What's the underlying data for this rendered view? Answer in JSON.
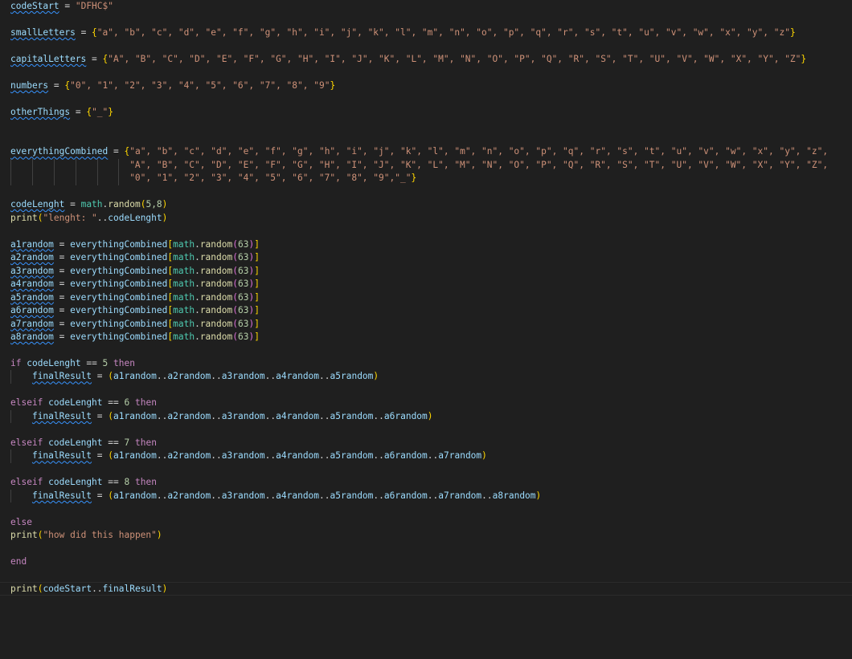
{
  "editor": {
    "code": {
      "code_start": {
        "var": "codeStart",
        "value": "\"DFHC$\""
      },
      "small_letters": {
        "var": "smallLetters",
        "values": "\"a\", \"b\", \"c\", \"d\", \"e\", \"f\", \"g\", \"h\", \"i\", \"j\", \"k\", \"l\", \"m\", \"n\", \"o\", \"p\", \"q\", \"r\", \"s\", \"t\", \"u\", \"v\", \"w\", \"x\", \"y\", \"z\""
      },
      "capital_letters": {
        "var": "capitalLetters",
        "values": "\"A\", \"B\", \"C\", \"D\", \"E\", \"F\", \"G\", \"H\", \"I\", \"J\", \"K\", \"L\", \"M\", \"N\", \"O\", \"P\", \"Q\", \"R\", \"S\", \"T\", \"U\", \"V\", \"W\", \"X\", \"Y\", \"Z\""
      },
      "numbers": {
        "var": "numbers",
        "values": "\"0\", \"1\", \"2\", \"3\", \"4\", \"5\", \"6\", \"7\", \"8\", \"9\""
      },
      "other_things": {
        "var": "otherThings",
        "values": "\"_\""
      },
      "everything_combined": {
        "var": "everythingCombined",
        "line1": "\"a\", \"b\", \"c\", \"d\", \"e\", \"f\", \"g\", \"h\", \"i\", \"j\", \"k\", \"l\", \"m\", \"n\", \"o\", \"p\", \"q\", \"r\", \"s\", \"t\", \"u\", \"v\", \"w\", \"x\", \"y\", \"z\",",
        "line2": "\"A\", \"B\", \"C\", \"D\", \"E\", \"F\", \"G\", \"H\", \"I\", \"J\", \"K\", \"L\", \"M\", \"N\", \"O\", \"P\", \"Q\", \"R\", \"S\", \"T\", \"U\", \"V\", \"W\", \"X\", \"Y\", \"Z\",",
        "line3": "\"0\", \"1\", \"2\", \"3\", \"4\", \"5\", \"6\", \"7\", \"8\", \"9\",\"_\""
      },
      "code_length": {
        "var": "codeLenght",
        "lib": "math",
        "fn": "random",
        "args": "5,8"
      },
      "print_length": {
        "fn": "print",
        "str": "\"lenght: \"",
        "concat": "..",
        "var": "codeLenght"
      },
      "random_vars": [
        "a1random",
        "a2random",
        "a3random",
        "a4random",
        "a5random",
        "a6random",
        "a7random",
        "a8random"
      ],
      "random_expr": {
        "table": "everythingCombined",
        "lib": "math",
        "fn": "random",
        "arg": "63"
      },
      "branches": [
        {
          "keyword": "if",
          "var": "codeLenght",
          "cmp": "==",
          "num": "5",
          "then": "then",
          "result": "finalResult",
          "expr": "a1random..a2random..a3random..a4random..a5random"
        },
        {
          "keyword": "elseif",
          "var": "codeLenght",
          "cmp": "==",
          "num": "6",
          "then": "then",
          "result": "finalResult",
          "expr": "a1random..a2random..a3random..a4random..a5random..a6random"
        },
        {
          "keyword": "elseif",
          "var": "codeLenght",
          "cmp": "==",
          "num": "7",
          "then": "then",
          "result": "finalResult",
          "expr": "a1random..a2random..a3random..a4random..a5random..a6random..a7random"
        },
        {
          "keyword": "elseif",
          "var": "codeLenght",
          "cmp": "==",
          "num": "8",
          "then": "then",
          "result": "finalResult",
          "expr": "a1random..a2random..a3random..a4random..a5random..a6random..a7random..a8random"
        }
      ],
      "else_keyword": "else",
      "else_print": {
        "fn": "print",
        "str": "\"how did this happen\""
      },
      "end_keyword": "end",
      "final_print": {
        "fn": "print",
        "arg1": "codeStart",
        "concat": "..",
        "arg2": "finalResult"
      }
    }
  }
}
